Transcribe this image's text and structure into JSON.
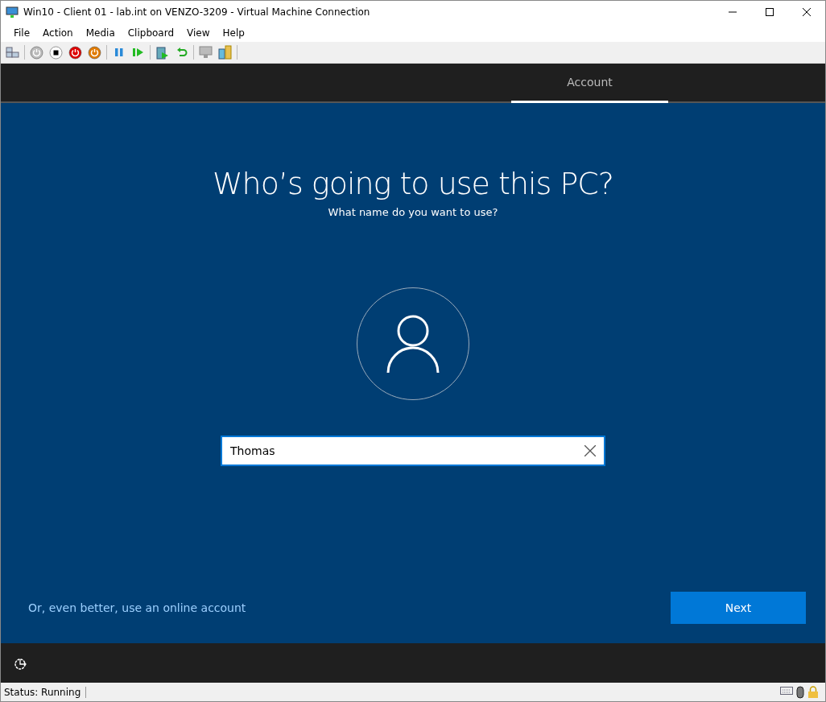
{
  "window": {
    "title": "Win10 - Client 01 - lab.int on VENZO-3209 - Virtual Machine Connection"
  },
  "menu": [
    "File",
    "Action",
    "Media",
    "Clipboard",
    "View",
    "Help"
  ],
  "tabs": [
    {
      "label": "Account",
      "selected": true
    }
  ],
  "setup": {
    "heading": "Who’s going to use this PC?",
    "subheading": "What name do you want to use?",
    "name_field": {
      "value": "Thomas"
    },
    "online_link": "Or, even better, use an online account",
    "next_button": "Next"
  },
  "status_bar": {
    "status": "Status: Running"
  }
}
